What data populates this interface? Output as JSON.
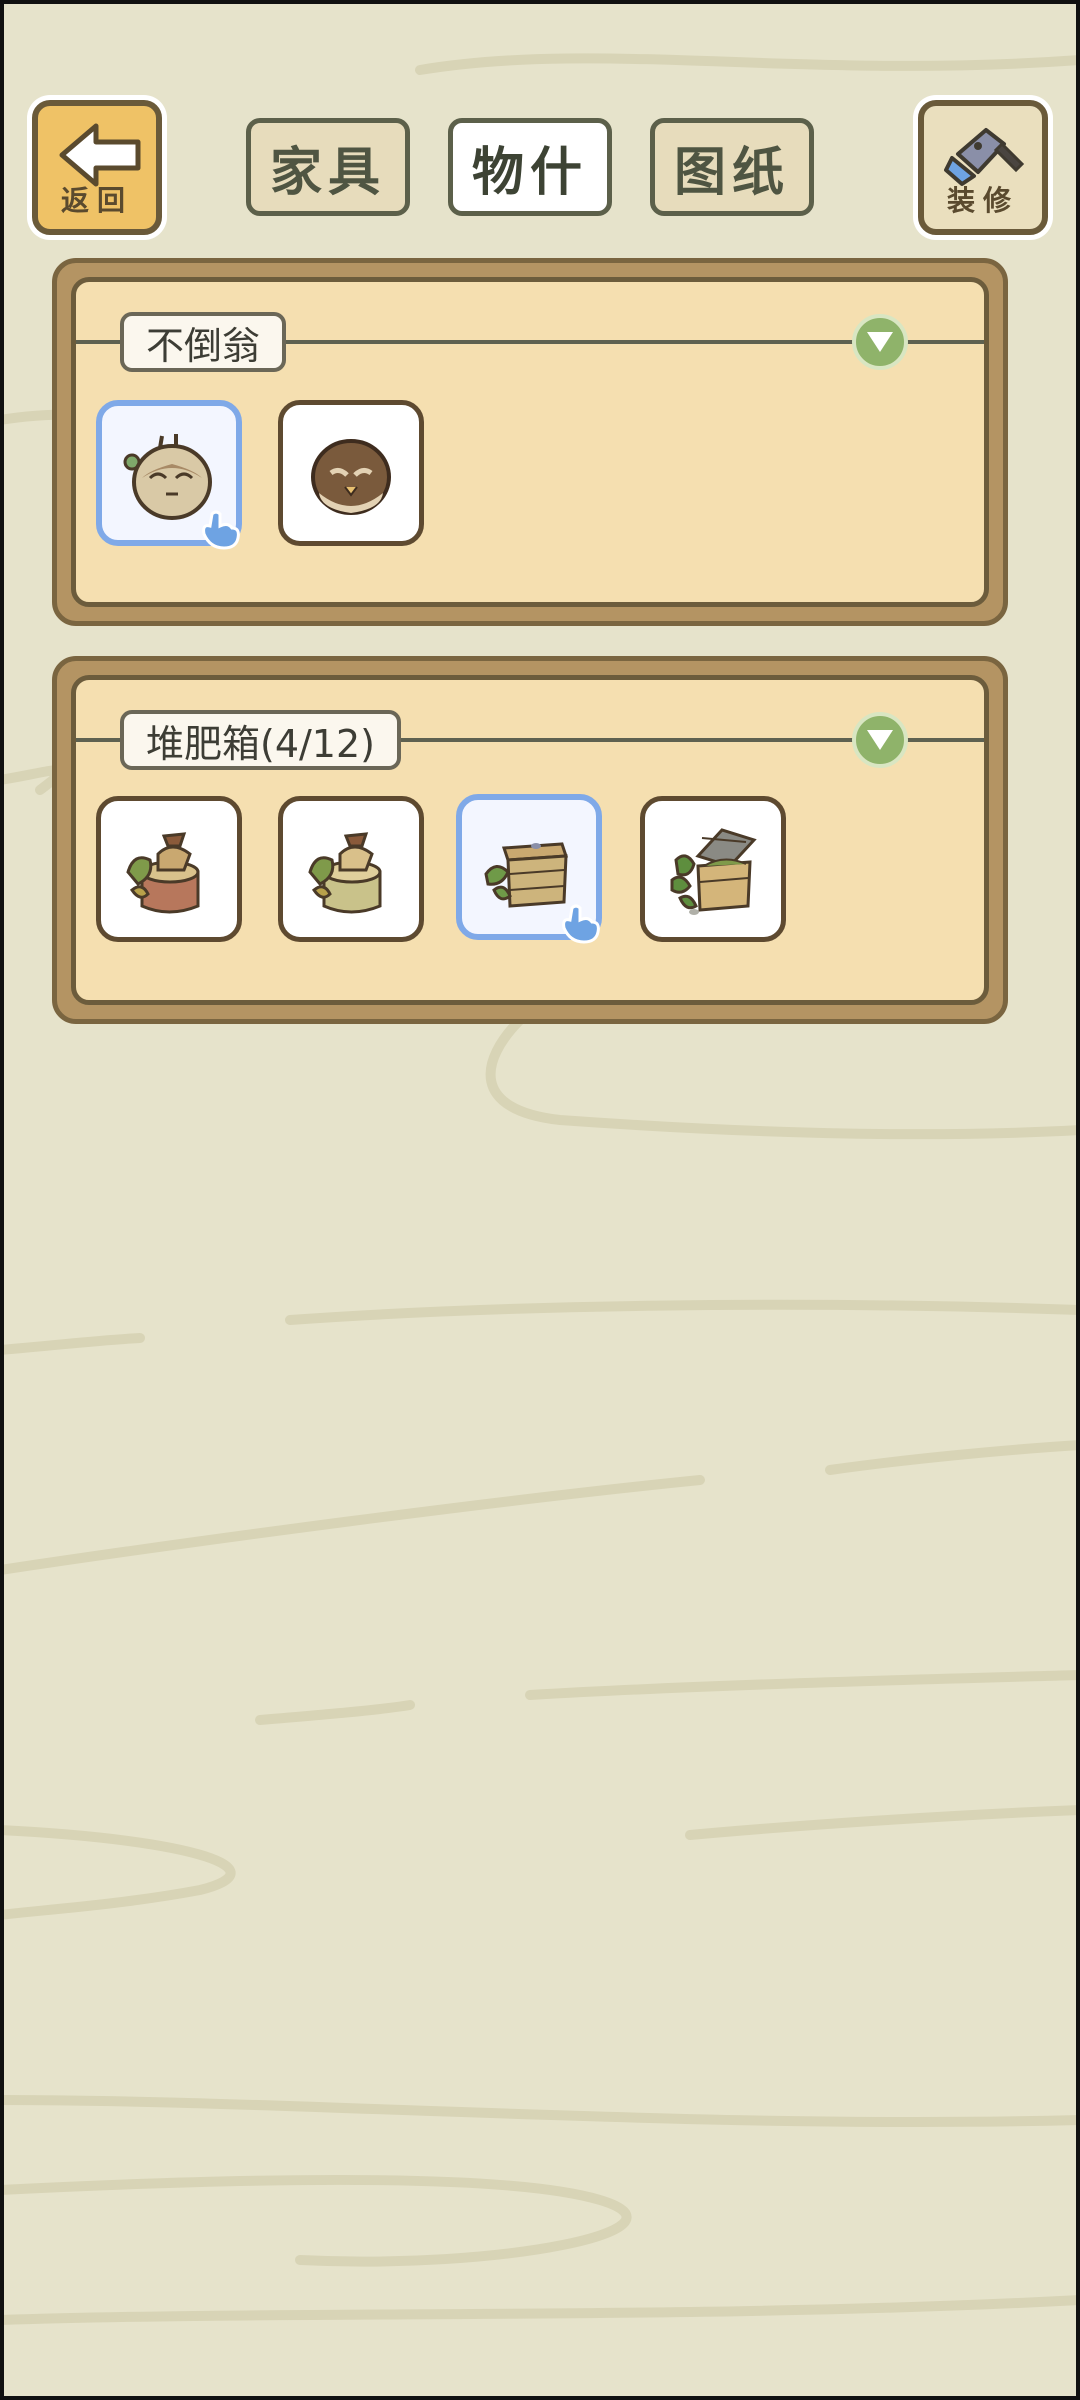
{
  "top_bar": {
    "back_label": "返回",
    "decor_label": "装修",
    "tabs": [
      {
        "label": "家具",
        "active": false
      },
      {
        "label": "物什",
        "active": true
      },
      {
        "label": "图纸",
        "active": false
      }
    ]
  },
  "panels": [
    {
      "title": "不倒翁",
      "items": [
        {
          "name": "tumbler-selected",
          "selected": true
        },
        {
          "name": "tumbler-brown",
          "selected": false
        }
      ]
    },
    {
      "title": "堆肥箱(4/12)",
      "items": [
        {
          "name": "compost-stump-red",
          "selected": false
        },
        {
          "name": "compost-stump-green",
          "selected": false
        },
        {
          "name": "compost-crate-closed",
          "selected": true
        },
        {
          "name": "compost-crate-open",
          "selected": false
        }
      ]
    }
  ],
  "colors": {
    "background": "#e6e3cb",
    "panel_fill": "#f5dfb0",
    "selected_border": "#7fa9e8",
    "expand_button": "#8fb36a"
  }
}
